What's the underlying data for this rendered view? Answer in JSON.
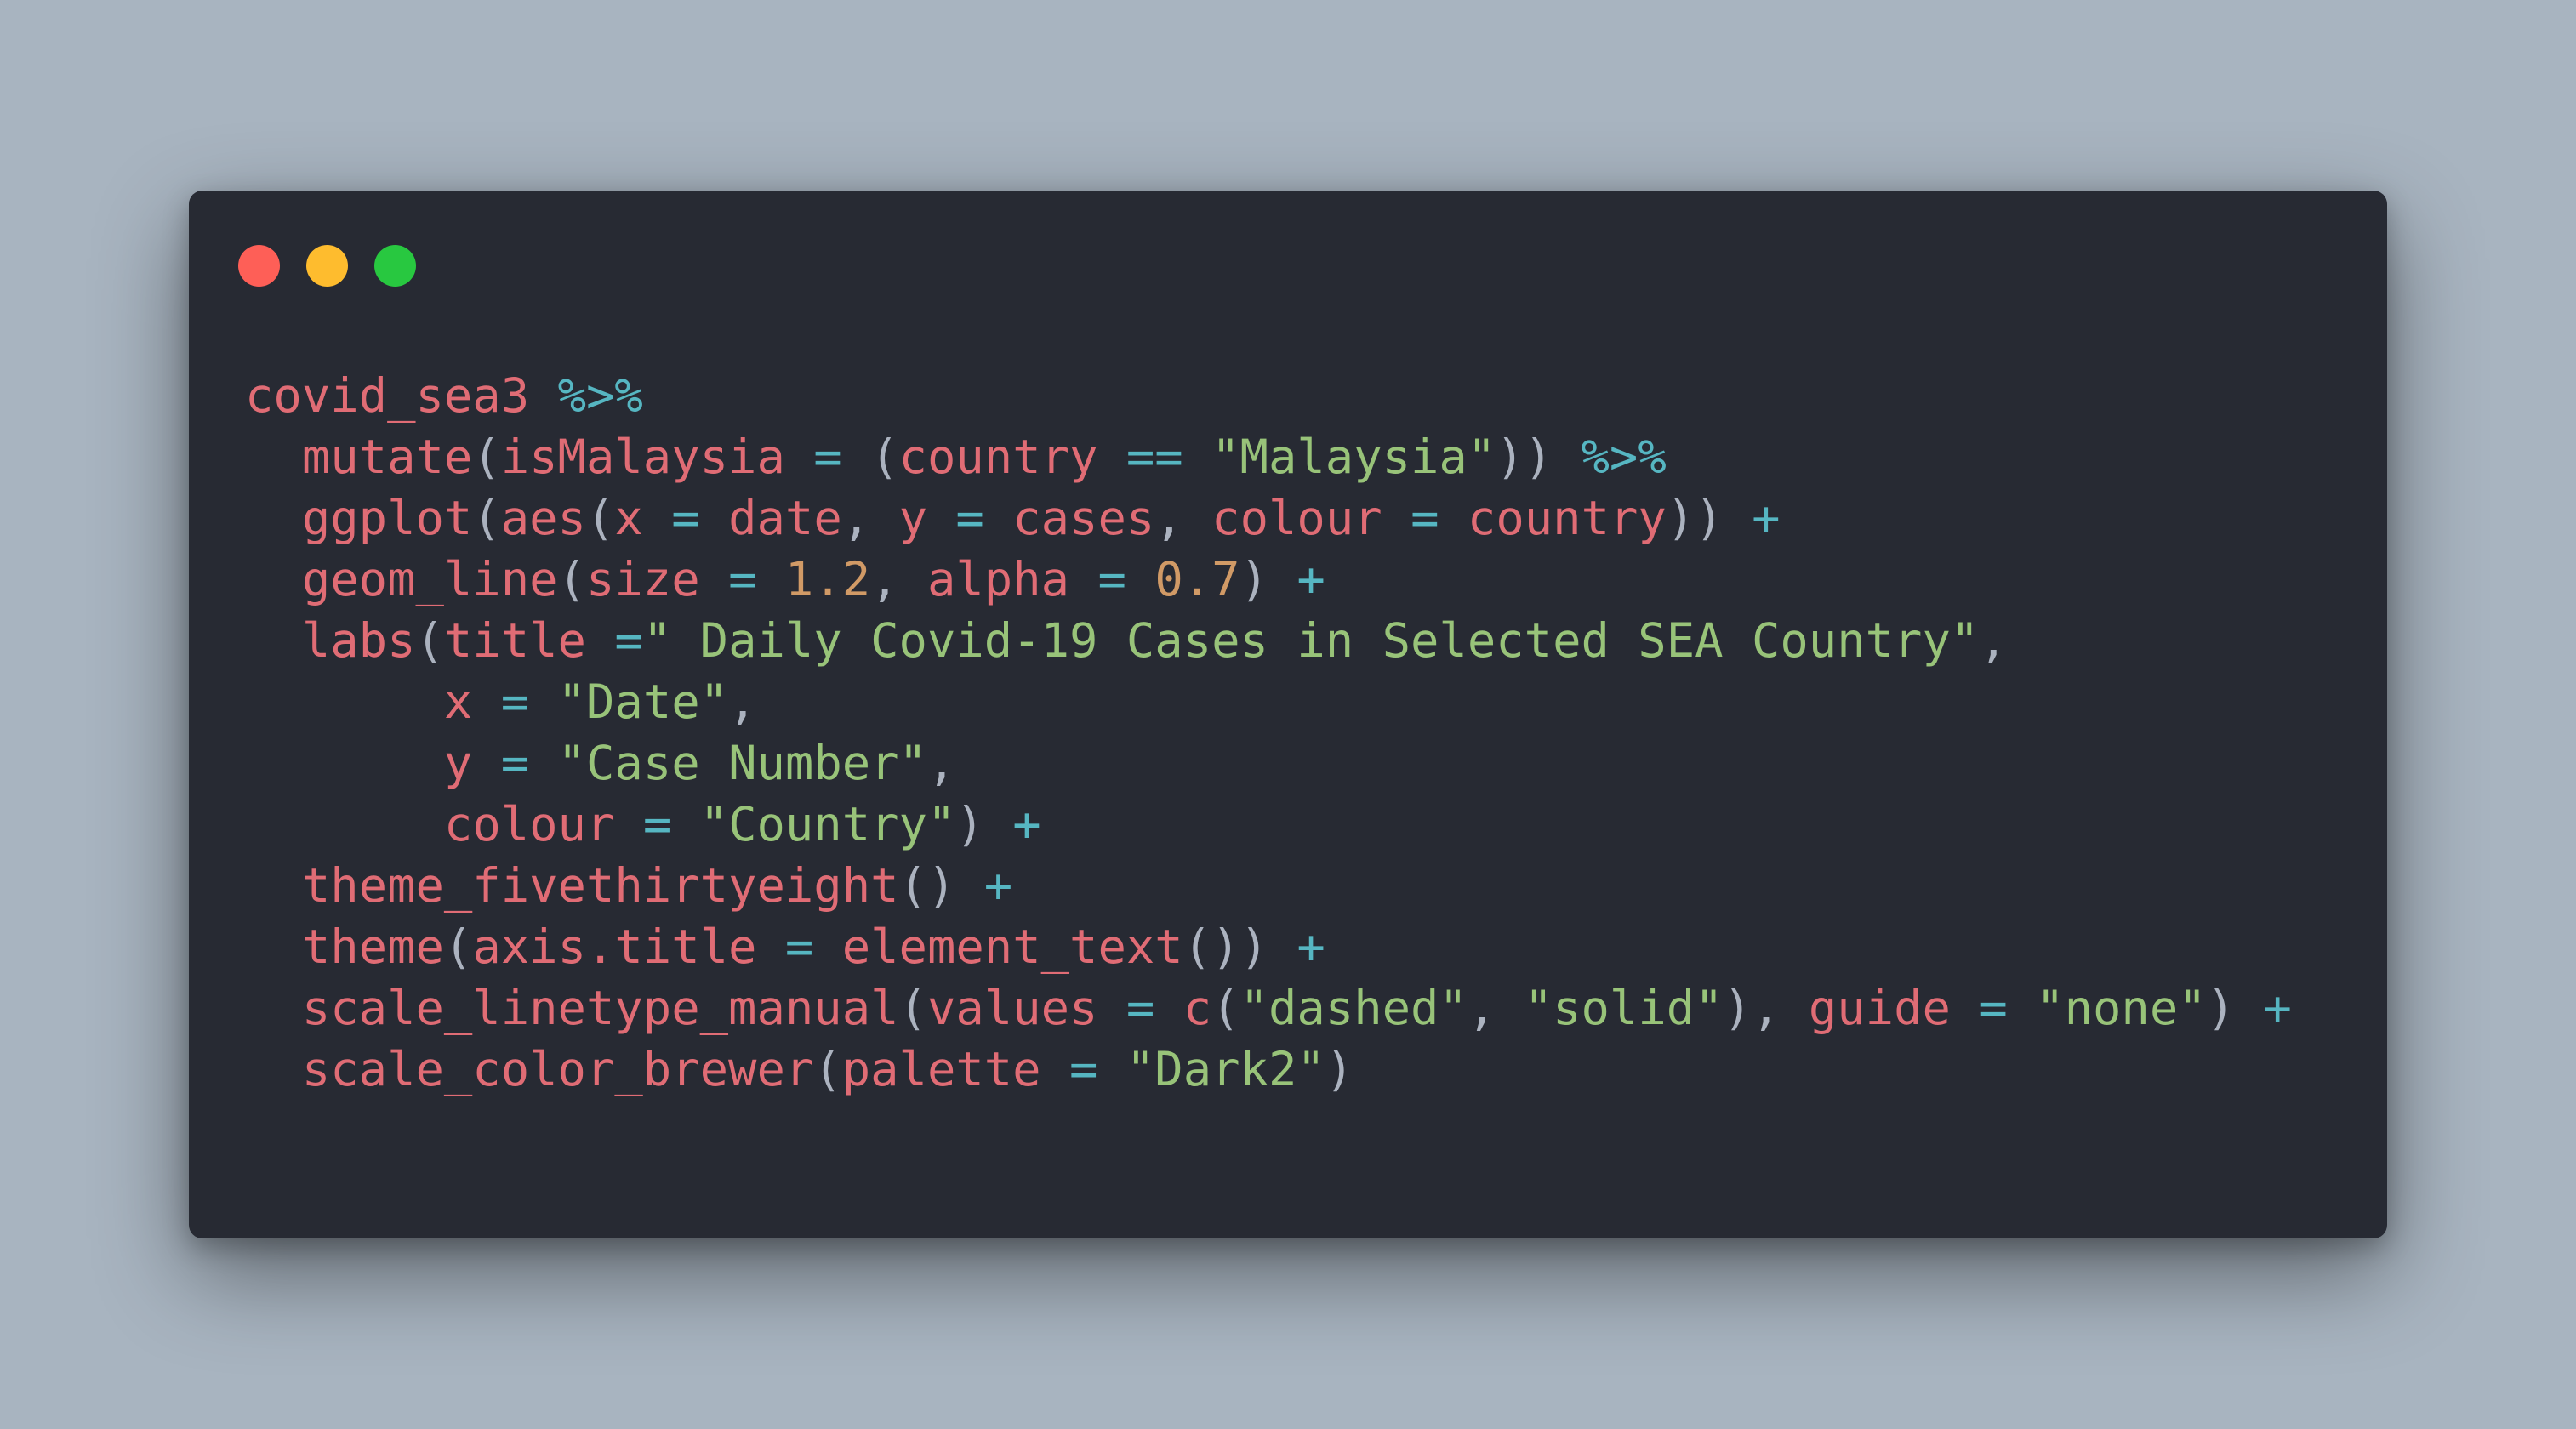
{
  "window": {
    "controls": [
      {
        "name": "close",
        "color": "#fe5f57"
      },
      {
        "name": "minimize",
        "color": "#febc2e"
      },
      {
        "name": "maximize",
        "color": "#28c840"
      }
    ]
  },
  "theme": {
    "background": "#a8b4c0",
    "window_bg": "#272a33",
    "identifier": "#e06c75",
    "string": "#98c379",
    "operator": "#56b6c2",
    "number": "#d19a66",
    "punctuation": "#abb2bf"
  },
  "code": {
    "language": "R",
    "lines": [
      [
        [
          "red",
          "covid_sea3"
        ],
        [
          "plain",
          " "
        ],
        [
          "cyan",
          "%>%"
        ]
      ],
      [
        [
          "plain",
          "  "
        ],
        [
          "red",
          "mutate"
        ],
        [
          "plain",
          "("
        ],
        [
          "red",
          "isMalaysia"
        ],
        [
          "plain",
          " "
        ],
        [
          "cyan",
          "="
        ],
        [
          "plain",
          " ("
        ],
        [
          "red",
          "country"
        ],
        [
          "plain",
          " "
        ],
        [
          "cyan",
          "=="
        ],
        [
          "plain",
          " "
        ],
        [
          "green",
          "\"Malaysia\""
        ],
        [
          "plain",
          "))"
        ],
        [
          "plain",
          " "
        ],
        [
          "cyan",
          "%>%"
        ]
      ],
      [
        [
          "plain",
          "  "
        ],
        [
          "red",
          "ggplot"
        ],
        [
          "plain",
          "("
        ],
        [
          "red",
          "aes"
        ],
        [
          "plain",
          "("
        ],
        [
          "red",
          "x"
        ],
        [
          "plain",
          " "
        ],
        [
          "cyan",
          "="
        ],
        [
          "plain",
          " "
        ],
        [
          "red",
          "date"
        ],
        [
          "plain",
          ", "
        ],
        [
          "red",
          "y"
        ],
        [
          "plain",
          " "
        ],
        [
          "cyan",
          "="
        ],
        [
          "plain",
          " "
        ],
        [
          "red",
          "cases"
        ],
        [
          "plain",
          ", "
        ],
        [
          "red",
          "colour"
        ],
        [
          "plain",
          " "
        ],
        [
          "cyan",
          "="
        ],
        [
          "plain",
          " "
        ],
        [
          "red",
          "country"
        ],
        [
          "plain",
          "))"
        ],
        [
          "plain",
          " "
        ],
        [
          "cyan",
          "+"
        ]
      ],
      [
        [
          "plain",
          "  "
        ],
        [
          "red",
          "geom_line"
        ],
        [
          "plain",
          "("
        ],
        [
          "red",
          "size"
        ],
        [
          "plain",
          " "
        ],
        [
          "cyan",
          "="
        ],
        [
          "plain",
          " "
        ],
        [
          "orange",
          "1.2"
        ],
        [
          "plain",
          ", "
        ],
        [
          "red",
          "alpha"
        ],
        [
          "plain",
          " "
        ],
        [
          "cyan",
          "="
        ],
        [
          "plain",
          " "
        ],
        [
          "orange",
          "0.7"
        ],
        [
          "plain",
          ")"
        ],
        [
          "plain",
          " "
        ],
        [
          "cyan",
          "+"
        ]
      ],
      [
        [
          "plain",
          "  "
        ],
        [
          "red",
          "labs"
        ],
        [
          "plain",
          "("
        ],
        [
          "red",
          "title"
        ],
        [
          "plain",
          " "
        ],
        [
          "cyan",
          "="
        ],
        [
          "green",
          "\" Daily Covid-19 Cases in Selected SEA Country\""
        ],
        [
          "plain",
          ","
        ]
      ],
      [
        [
          "plain",
          "       "
        ],
        [
          "red",
          "x"
        ],
        [
          "plain",
          " "
        ],
        [
          "cyan",
          "="
        ],
        [
          "plain",
          " "
        ],
        [
          "green",
          "\"Date\""
        ],
        [
          "plain",
          ","
        ]
      ],
      [
        [
          "plain",
          "       "
        ],
        [
          "red",
          "y"
        ],
        [
          "plain",
          " "
        ],
        [
          "cyan",
          "="
        ],
        [
          "plain",
          " "
        ],
        [
          "green",
          "\"Case Number\""
        ],
        [
          "plain",
          ","
        ]
      ],
      [
        [
          "plain",
          "       "
        ],
        [
          "red",
          "colour"
        ],
        [
          "plain",
          " "
        ],
        [
          "cyan",
          "="
        ],
        [
          "plain",
          " "
        ],
        [
          "green",
          "\"Country\""
        ],
        [
          "plain",
          ")"
        ],
        [
          "plain",
          " "
        ],
        [
          "cyan",
          "+"
        ]
      ],
      [
        [
          "plain",
          "  "
        ],
        [
          "red",
          "theme_fivethirtyeight"
        ],
        [
          "plain",
          "()"
        ],
        [
          "plain",
          " "
        ],
        [
          "cyan",
          "+"
        ]
      ],
      [
        [
          "plain",
          "  "
        ],
        [
          "red",
          "theme"
        ],
        [
          "plain",
          "("
        ],
        [
          "red",
          "axis.title"
        ],
        [
          "plain",
          " "
        ],
        [
          "cyan",
          "="
        ],
        [
          "plain",
          " "
        ],
        [
          "red",
          "element_text"
        ],
        [
          "plain",
          "())"
        ],
        [
          "plain",
          " "
        ],
        [
          "cyan",
          "+"
        ]
      ],
      [
        [
          "plain",
          "  "
        ],
        [
          "red",
          "scale_linetype_manual"
        ],
        [
          "plain",
          "("
        ],
        [
          "red",
          "values"
        ],
        [
          "plain",
          " "
        ],
        [
          "cyan",
          "="
        ],
        [
          "plain",
          " "
        ],
        [
          "red",
          "c"
        ],
        [
          "plain",
          "("
        ],
        [
          "green",
          "\"dashed\""
        ],
        [
          "plain",
          ", "
        ],
        [
          "green",
          "\"solid\""
        ],
        [
          "plain",
          "), "
        ],
        [
          "red",
          "guide"
        ],
        [
          "plain",
          " "
        ],
        [
          "cyan",
          "="
        ],
        [
          "plain",
          " "
        ],
        [
          "green",
          "\"none\""
        ],
        [
          "plain",
          ")"
        ],
        [
          "plain",
          " "
        ],
        [
          "cyan",
          "+"
        ]
      ],
      [
        [
          "plain",
          "  "
        ],
        [
          "red",
          "scale_color_brewer"
        ],
        [
          "plain",
          "("
        ],
        [
          "red",
          "palette"
        ],
        [
          "plain",
          " "
        ],
        [
          "cyan",
          "="
        ],
        [
          "plain",
          " "
        ],
        [
          "green",
          "\"Dark2\""
        ],
        [
          "plain",
          ")"
        ]
      ]
    ]
  }
}
